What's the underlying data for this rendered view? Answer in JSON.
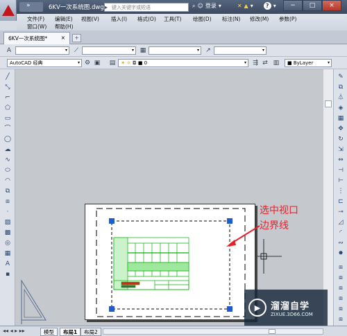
{
  "app": {
    "title": "6KV一次系统图.dwg",
    "search_placeholder": "键入关键字或短语",
    "login": "登录"
  },
  "menu": [
    "文件(F)",
    "编辑(E)",
    "视图(V)",
    "插入(I)",
    "格式(O)",
    "工具(T)",
    "绘图(D)",
    "标注(N)",
    "修改(M)",
    "参数(P)",
    "窗口(W)",
    "帮助(H)"
  ],
  "file_tab": {
    "label": "6KV一次系统图*",
    "close": "×"
  },
  "toolbar": {
    "workspace": "AutoCAD 经典",
    "layer": "0",
    "color": "ByLayer"
  },
  "layout_tabs": [
    "模型",
    "布局1",
    "布局2"
  ],
  "annotation": {
    "line1": "选中视口",
    "line2": "边界线"
  },
  "watermark": {
    "name": "溜溜自学",
    "url": "ZIXUE.3D66.COM"
  },
  "icons": {
    "logo": "autocad-logo-icon",
    "search": "search-icon",
    "close": "close-icon",
    "help": "help-icon"
  }
}
